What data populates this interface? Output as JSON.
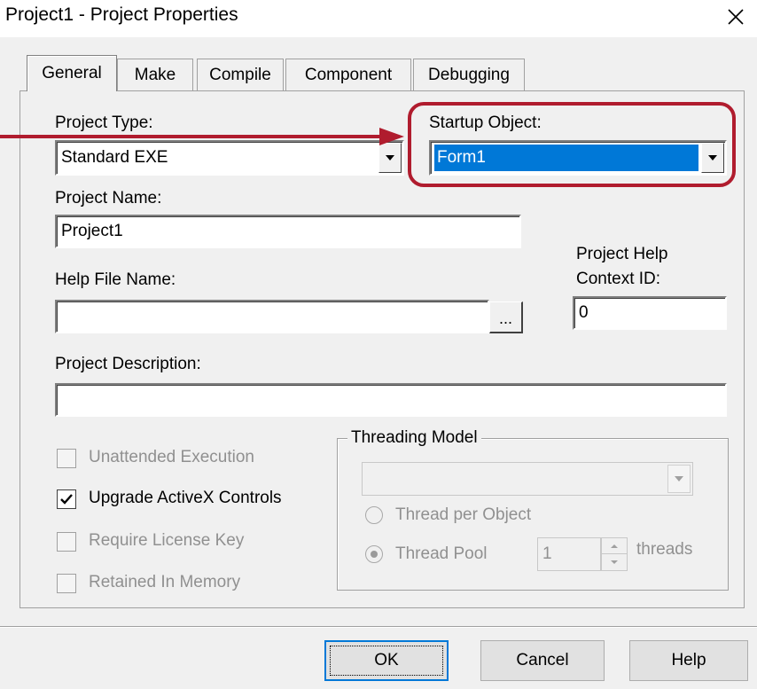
{
  "window": {
    "title": "Project1 - Project Properties"
  },
  "tabs": [
    "General",
    "Make",
    "Compile",
    "Component",
    "Debugging"
  ],
  "general": {
    "project_type": {
      "label": "Project Type:",
      "value": "Standard EXE"
    },
    "startup_object": {
      "label": "Startup Object:",
      "value": "Form1"
    },
    "project_name": {
      "label": "Project Name:",
      "value": "Project1"
    },
    "help_file_name": {
      "label": "Help File Name:",
      "value": "",
      "browse_label": "..."
    },
    "help_context": {
      "label_line1": "Project Help",
      "label_line2": "Context ID:",
      "value": "0"
    },
    "project_description": {
      "label": "Project Description:",
      "value": ""
    },
    "checkboxes": [
      {
        "label": "Unattended Execution",
        "checked": false,
        "enabled": false
      },
      {
        "label": "Upgrade ActiveX Controls",
        "checked": true,
        "enabled": true
      },
      {
        "label": "Require License Key",
        "checked": false,
        "enabled": false
      },
      {
        "label": "Retained In Memory",
        "checked": false,
        "enabled": false
      }
    ],
    "threading": {
      "title": "Threading Model",
      "model_value": "",
      "thread_per_object": "Thread per Object",
      "thread_pool": "Thread Pool",
      "threads_value": "1",
      "threads_label": "threads",
      "selected": "thread_pool"
    }
  },
  "buttons": {
    "ok": "OK",
    "cancel": "Cancel",
    "help": "Help"
  },
  "colors": {
    "accent": "#0078d7",
    "annotation": "#b01c2e",
    "dialog_bg": "#f0f0f0"
  }
}
